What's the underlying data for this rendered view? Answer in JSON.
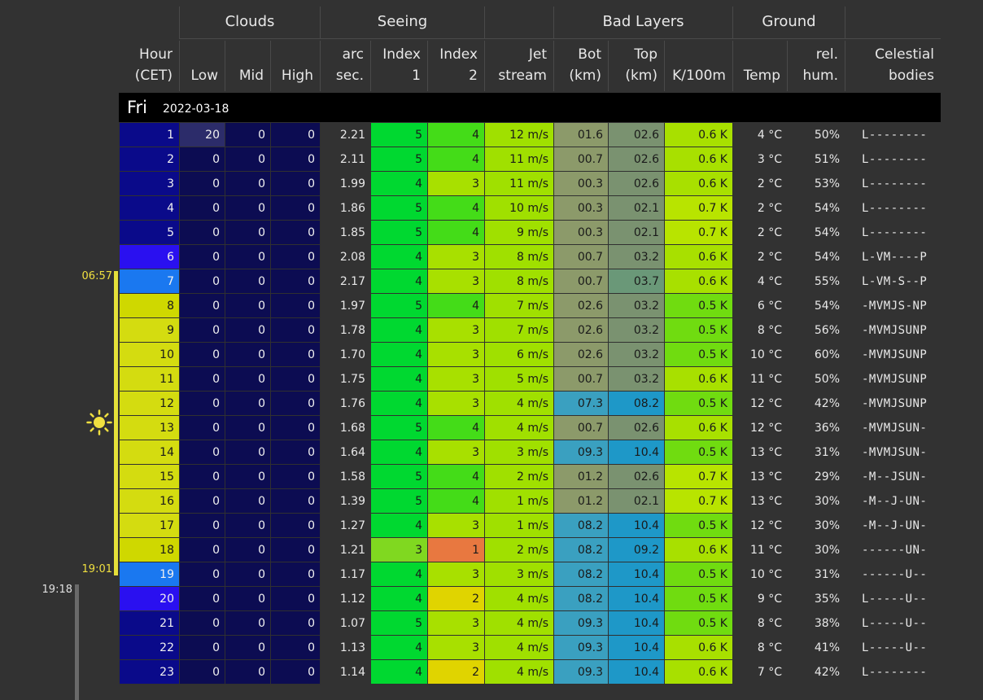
{
  "side": {
    "sunrise": "06:57",
    "sunset": "19:01",
    "dusk": "19:18"
  },
  "groups": [
    "Clouds",
    "Seeing",
    "Bad Layers",
    "Ground"
  ],
  "columns": [
    {
      "l1": "Hour",
      "l2": "(CET)"
    },
    {
      "l1": "",
      "l2": "Low"
    },
    {
      "l1": "",
      "l2": "Mid"
    },
    {
      "l1": "",
      "l2": "High"
    },
    {
      "l1": "arc",
      "l2": "sec."
    },
    {
      "l1": "Index",
      "l2": "1"
    },
    {
      "l1": "Index",
      "l2": "2"
    },
    {
      "l1": "Jet",
      "l2": "stream"
    },
    {
      "l1": "Bot",
      "l2": "(km)"
    },
    {
      "l1": "Top",
      "l2": "(km)"
    },
    {
      "l1": "",
      "l2": "K/100m"
    },
    {
      "l1": "",
      "l2": "Temp"
    },
    {
      "l1": "rel.",
      "l2": "hum."
    },
    {
      "l1": "Celestial",
      "l2": "bodies"
    }
  ],
  "day": {
    "name": "Fri",
    "date": "2022-03-18"
  },
  "rows": [
    {
      "hour": "1",
      "low": "20",
      "mid": "0",
      "high": "0",
      "arc": "2.21",
      "i1": "5",
      "i2": "4",
      "jet": "12 m/s",
      "bot": "01.6",
      "top": "02.6",
      "k": "0.6 K",
      "temp": "4 °C",
      "hum": "50%",
      "cel": "L--------"
    },
    {
      "hour": "2",
      "low": "0",
      "mid": "0",
      "high": "0",
      "arc": "2.11",
      "i1": "5",
      "i2": "4",
      "jet": "11 m/s",
      "bot": "00.7",
      "top": "02.6",
      "k": "0.6 K",
      "temp": "3 °C",
      "hum": "51%",
      "cel": "L--------"
    },
    {
      "hour": "3",
      "low": "0",
      "mid": "0",
      "high": "0",
      "arc": "1.99",
      "i1": "4",
      "i2": "3",
      "jet": "11 m/s",
      "bot": "00.3",
      "top": "02.6",
      "k": "0.6 K",
      "temp": "2 °C",
      "hum": "53%",
      "cel": "L--------"
    },
    {
      "hour": "4",
      "low": "0",
      "mid": "0",
      "high": "0",
      "arc": "1.86",
      "i1": "5",
      "i2": "4",
      "jet": "10 m/s",
      "bot": "00.3",
      "top": "02.1",
      "k": "0.7 K",
      "temp": "2 °C",
      "hum": "54%",
      "cel": "L--------"
    },
    {
      "hour": "5",
      "low": "0",
      "mid": "0",
      "high": "0",
      "arc": "1.85",
      "i1": "5",
      "i2": "4",
      "jet": "9 m/s",
      "bot": "00.3",
      "top": "02.1",
      "k": "0.7 K",
      "temp": "2 °C",
      "hum": "54%",
      "cel": "L--------"
    },
    {
      "hour": "6",
      "low": "0",
      "mid": "0",
      "high": "0",
      "arc": "2.08",
      "i1": "4",
      "i2": "3",
      "jet": "8 m/s",
      "bot": "00.7",
      "top": "03.2",
      "k": "0.6 K",
      "temp": "2 °C",
      "hum": "54%",
      "cel": "L-VM----P"
    },
    {
      "hour": "7",
      "low": "0",
      "mid": "0",
      "high": "0",
      "arc": "2.17",
      "i1": "4",
      "i2": "3",
      "jet": "8 m/s",
      "bot": "00.7",
      "top": "03.7",
      "k": "0.6 K",
      "temp": "4 °C",
      "hum": "55%",
      "cel": "L-VM-S--P"
    },
    {
      "hour": "8",
      "low": "0",
      "mid": "0",
      "high": "0",
      "arc": "1.97",
      "i1": "5",
      "i2": "4",
      "jet": "7 m/s",
      "bot": "02.6",
      "top": "03.2",
      "k": "0.5 K",
      "temp": "6 °C",
      "hum": "54%",
      "cel": "-MVMJS-NP"
    },
    {
      "hour": "9",
      "low": "0",
      "mid": "0",
      "high": "0",
      "arc": "1.78",
      "i1": "4",
      "i2": "3",
      "jet": "7 m/s",
      "bot": "02.6",
      "top": "03.2",
      "k": "0.5 K",
      "temp": "8 °C",
      "hum": "56%",
      "cel": "-MVMJSUNP"
    },
    {
      "hour": "10",
      "low": "0",
      "mid": "0",
      "high": "0",
      "arc": "1.70",
      "i1": "4",
      "i2": "3",
      "jet": "6 m/s",
      "bot": "02.6",
      "top": "03.2",
      "k": "0.5 K",
      "temp": "10 °C",
      "hum": "60%",
      "cel": "-MVMJSUNP"
    },
    {
      "hour": "11",
      "low": "0",
      "mid": "0",
      "high": "0",
      "arc": "1.75",
      "i1": "4",
      "i2": "3",
      "jet": "5 m/s",
      "bot": "00.7",
      "top": "03.2",
      "k": "0.6 K",
      "temp": "11 °C",
      "hum": "50%",
      "cel": "-MVMJSUNP"
    },
    {
      "hour": "12",
      "low": "0",
      "mid": "0",
      "high": "0",
      "arc": "1.76",
      "i1": "4",
      "i2": "3",
      "jet": "4 m/s",
      "bot": "07.3",
      "top": "08.2",
      "k": "0.5 K",
      "temp": "12 °C",
      "hum": "42%",
      "cel": "-MVMJSUNP"
    },
    {
      "hour": "13",
      "low": "0",
      "mid": "0",
      "high": "0",
      "arc": "1.68",
      "i1": "5",
      "i2": "4",
      "jet": "4 m/s",
      "bot": "00.7",
      "top": "02.6",
      "k": "0.6 K",
      "temp": "12 °C",
      "hum": "36%",
      "cel": "-MVMJSUN-"
    },
    {
      "hour": "14",
      "low": "0",
      "mid": "0",
      "high": "0",
      "arc": "1.64",
      "i1": "4",
      "i2": "3",
      "jet": "3 m/s",
      "bot": "09.3",
      "top": "10.4",
      "k": "0.5 K",
      "temp": "13 °C",
      "hum": "31%",
      "cel": "-MVMJSUN-"
    },
    {
      "hour": "15",
      "low": "0",
      "mid": "0",
      "high": "0",
      "arc": "1.58",
      "i1": "5",
      "i2": "4",
      "jet": "2 m/s",
      "bot": "01.2",
      "top": "02.6",
      "k": "0.7 K",
      "temp": "13 °C",
      "hum": "29%",
      "cel": "-M--JSUN-"
    },
    {
      "hour": "16",
      "low": "0",
      "mid": "0",
      "high": "0",
      "arc": "1.39",
      "i1": "5",
      "i2": "4",
      "jet": "1 m/s",
      "bot": "01.2",
      "top": "02.1",
      "k": "0.7 K",
      "temp": "13 °C",
      "hum": "30%",
      "cel": "-M--J-UN-"
    },
    {
      "hour": "17",
      "low": "0",
      "mid": "0",
      "high": "0",
      "arc": "1.27",
      "i1": "4",
      "i2": "3",
      "jet": "1 m/s",
      "bot": "08.2",
      "top": "10.4",
      "k": "0.5 K",
      "temp": "12 °C",
      "hum": "30%",
      "cel": "-M--J-UN-"
    },
    {
      "hour": "18",
      "low": "0",
      "mid": "0",
      "high": "0",
      "arc": "1.21",
      "i1": "3",
      "i2": "1",
      "jet": "2 m/s",
      "bot": "08.2",
      "top": "09.2",
      "k": "0.6 K",
      "temp": "11 °C",
      "hum": "30%",
      "cel": "------UN-"
    },
    {
      "hour": "19",
      "low": "0",
      "mid": "0",
      "high": "0",
      "arc": "1.17",
      "i1": "4",
      "i2": "3",
      "jet": "3 m/s",
      "bot": "08.2",
      "top": "10.4",
      "k": "0.5 K",
      "temp": "10 °C",
      "hum": "31%",
      "cel": "------U--"
    },
    {
      "hour": "20",
      "low": "0",
      "mid": "0",
      "high": "0",
      "arc": "1.12",
      "i1": "4",
      "i2": "2",
      "jet": "4 m/s",
      "bot": "08.2",
      "top": "10.4",
      "k": "0.5 K",
      "temp": "9 °C",
      "hum": "35%",
      "cel": "L-----U--"
    },
    {
      "hour": "21",
      "low": "0",
      "mid": "0",
      "high": "0",
      "arc": "1.07",
      "i1": "5",
      "i2": "3",
      "jet": "4 m/s",
      "bot": "09.3",
      "top": "10.4",
      "k": "0.5 K",
      "temp": "8 °C",
      "hum": "38%",
      "cel": "L-----U--"
    },
    {
      "hour": "22",
      "low": "0",
      "mid": "0",
      "high": "0",
      "arc": "1.13",
      "i1": "4",
      "i2": "3",
      "jet": "4 m/s",
      "bot": "09.3",
      "top": "10.4",
      "k": "0.6 K",
      "temp": "8 °C",
      "hum": "41%",
      "cel": "L-----U--"
    },
    {
      "hour": "23",
      "low": "0",
      "mid": "0",
      "high": "0",
      "arc": "1.14",
      "i1": "4",
      "i2": "2",
      "jet": "4 m/s",
      "bot": "09.3",
      "top": "10.4",
      "k": "0.6 K",
      "temp": "7 °C",
      "hum": "42%",
      "cel": "L--------"
    }
  ],
  "colors": {
    "hour": [
      "#0a0a8a",
      "#0a0a8a",
      "#0a0a8a",
      "#0a0a8a",
      "#0a0a8a",
      "#2a10f0",
      "#1a78f0",
      "#cfd800",
      "#d4dc10",
      "#d4dc10",
      "#d4dc10",
      "#d4dc10",
      "#d4dc10",
      "#d4dc10",
      "#d4dc10",
      "#d4dc10",
      "#d4dc10",
      "#cfd800",
      "#1a78f0",
      "#2a10f0",
      "#0a0a8a",
      "#0a0a8a",
      "#0a0a8a"
    ],
    "cloud_zero": "#0c0c52",
    "cloud_low_20": "#2c2c6a",
    "arc": "#323232",
    "index": {
      "5": "#00d830",
      "4": "#44dc18",
      "3": "#a8e000",
      "2": "#e0d400",
      "1": "#e87840"
    },
    "i1": {
      "5": "#00d830",
      "4": "#00d830",
      "3": "#80d820"
    },
    "i2": {
      "4": "#44dc18",
      "3": "#a8e000",
      "2": "#e0d400",
      "1": "#e87840"
    },
    "jet": "#a0e000",
    "layer_low": "#8c9a6a",
    "layer_mid": "#7a9270",
    "layer_high": "#3aa0c0",
    "layer_top_high": "#1e98c8",
    "k_06": "#a8e000",
    "k_07": "#b8e400",
    "k_05": "#70dc10",
    "sun": "#f0e040"
  }
}
